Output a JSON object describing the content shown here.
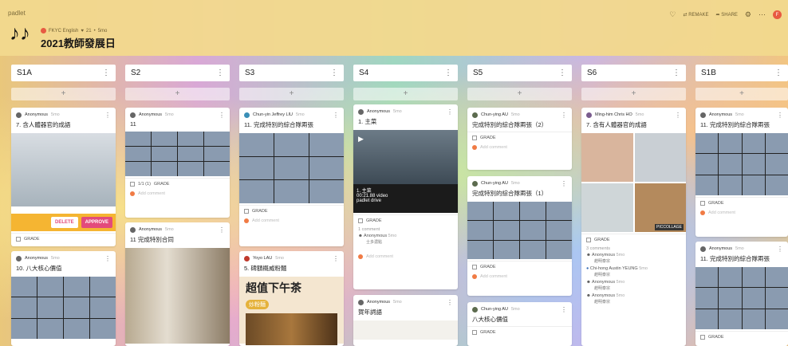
{
  "app": {
    "brand": "padlet"
  },
  "header": {
    "title": "2021教師發展日",
    "meta": {
      "author": "FKYC English",
      "count": "21",
      "time": "5mo"
    },
    "tools": {
      "remake": "REMAKE",
      "share": "SHARE",
      "avatar": "F"
    }
  },
  "columns": [
    {
      "name": "S1A"
    },
    {
      "name": "S2"
    },
    {
      "name": "S3"
    },
    {
      "name": "S4"
    },
    {
      "name": "S5"
    },
    {
      "name": "S6"
    },
    {
      "name": "S1B"
    }
  ],
  "common": {
    "add": "+",
    "grade": "GRADE",
    "add_comment": "Add comment",
    "anon": "Anonymous",
    "t5": "5mo"
  },
  "cards": {
    "s1a_1": {
      "title": "7. 含人體器官的成語",
      "delete": "DELETE",
      "approve": "APPROVE"
    },
    "s1a_2": {
      "title": "10. 八大核心價值"
    },
    "s2_1": {
      "title": "11",
      "grade_count": "1/1 (1)"
    },
    "s2_2": {
      "title": "11 完成特別合同"
    },
    "s3_1": {
      "author": "Chun-yin Jeffrey LIU",
      "title": "11. 完成特別的綜合隊兩張"
    },
    "s3_2": {
      "author": "Yoyo LAU",
      "title": "5. 碑額概威粉麵",
      "poster_text": "超值下午茶",
      "poster_sub": "炒粉麵"
    },
    "s4_1": {
      "title": "1. 主菜",
      "video_title": "1. 主菜",
      "video_time": "00:21.88 video",
      "video_src": "padlet drive",
      "comment_count": "1 comment",
      "comment_text": "士多濃點"
    },
    "s4_2": {
      "title": "賀年詞語"
    },
    "s5_1": {
      "author": "Chun-ying AU",
      "title": "完成特別的綜合隊兩張（2）"
    },
    "s5_2": {
      "author": "Chun-ying AU",
      "title": "完成特別的綜合隊兩張（1）"
    },
    "s5_3": {
      "author": "Chun-ying AU",
      "title": "八大核心價值"
    },
    "s6_1": {
      "author": "Ming-him Chris HO",
      "title": "7. 含有人體器官的成語",
      "collage": "PICCOLLAGE",
      "comments": "3 comments",
      "replies": [
        {
          "author": "Anonymous",
          "text": "趙明泰宗"
        },
        {
          "author": "Chi-hong Austin YEUNG",
          "text": "趙明泰宗"
        },
        {
          "author": "Anonymous",
          "text": "趙明泰宗"
        },
        {
          "author": "Anonymous",
          "text": "趙明泰宗"
        }
      ]
    },
    "s1b_1": {
      "title": "11. 完成特別的綜合隊兩張"
    },
    "s1b_2": {
      "title": "11. 完成特別的綜合隊兩張"
    }
  }
}
